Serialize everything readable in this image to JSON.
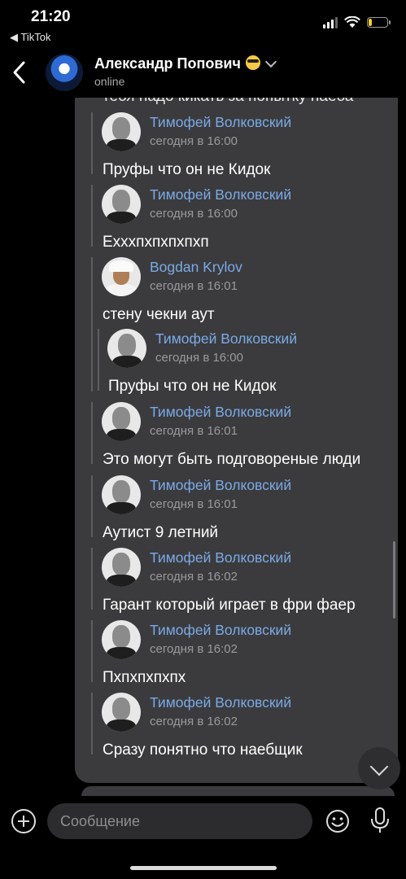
{
  "status_bar": {
    "time": "21:20",
    "back_app": "◀ TikTok",
    "battery_level": 0.2,
    "battery_color": "#f6d12a"
  },
  "header": {
    "name": "Александр Попович",
    "status": "online"
  },
  "chat": {
    "cut_text": "тебя надо кикать за попытку наеба",
    "accent_name_color": "#7aaae6",
    "messages": [
      {
        "author": "Тимофей Волковский",
        "date": "сегодня в 16:00",
        "text": "Пруфы что он не Кидок"
      },
      {
        "author": "Тимофей Волковский",
        "date": "сегодня в 16:00",
        "text": "Ехххпхпхпхпхп"
      },
      {
        "author": "Bogdan Krylov",
        "date": "сегодня в 16:01",
        "text": "стену чекни аут",
        "nested": {
          "author": "Тимофей Волковский",
          "date": "сегодня в 16:00",
          "text": "Пруфы что он не Кидок"
        }
      },
      {
        "author": "Тимофей Волковский",
        "date": "сегодня в 16:01",
        "text": "Это могут быть подговореные люди"
      },
      {
        "author": "Тимофей Волковский",
        "date": "сегодня в 16:01",
        "text": "Аутист 9 летний"
      },
      {
        "author": "Тимофей Волковский",
        "date": "сегодня в 16:02",
        "text": "Гарант который играет в фри фаер"
      },
      {
        "author": "Тимофей Волковский",
        "date": "сегодня в 16:02",
        "text": "Пхпхпхпхпх"
      },
      {
        "author": "Тимофей Волковский",
        "date": "сегодня в 16:02",
        "text": "Сразу понятно что наебщик"
      }
    ]
  },
  "composer": {
    "placeholder": "Сообщение"
  },
  "icons": {
    "back": "chevron-left-icon",
    "attach": "plus-circle-icon",
    "emoji": "smile-icon",
    "mic": "microphone-icon",
    "scroll_down": "chevron-down-icon"
  }
}
